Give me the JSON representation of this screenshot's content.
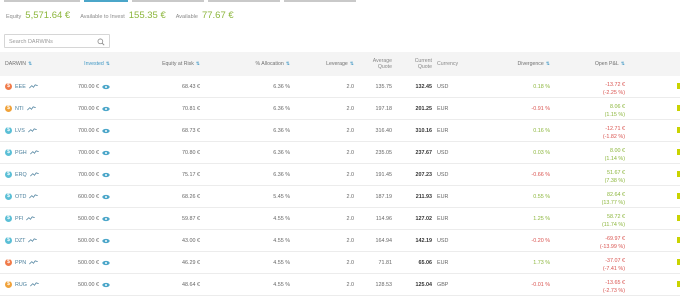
{
  "summary": [
    {
      "label": "Equity",
      "value": "5,571.64 €"
    },
    {
      "label": "Available to Invest",
      "value": "155.35 €"
    },
    {
      "label": "Available",
      "value": "77.67 €"
    }
  ],
  "search": {
    "placeholder": "Search DARWINs"
  },
  "columns": [
    {
      "label": "DARWIN",
      "sort": "⇅"
    },
    {
      "label": "Invested",
      "sort": "⇅"
    },
    {
      "label": "Equity at Risk",
      "sort": "⇅"
    },
    {
      "label": "% Allocation",
      "sort": "⇅"
    },
    {
      "label": "Leverage",
      "sort": "⇅"
    },
    {
      "label": "Average Quote",
      "sort": ""
    },
    {
      "label": "Current Quote",
      "sort": ""
    },
    {
      "label": "Currency",
      "sort": ""
    },
    {
      "label": "Divergence",
      "sort": "⇅"
    },
    {
      "label": "Open P&L",
      "sort": "⇅"
    }
  ],
  "rows": [
    {
      "name": "EEE",
      "icon_color": "#f07b4a",
      "invested": "700.00 €",
      "risk": "68.43 €",
      "alloc": "6.36 %",
      "leverage": "2.0",
      "avg": "135.75",
      "cur": "132.45",
      "currency": "USD",
      "div": "0.18 %",
      "div_sign": "pos",
      "pnl": "-13.72 €",
      "pnl_pct": "(-2.25 %)",
      "pnl_sign": "neg"
    },
    {
      "name": "NTI",
      "icon_color": "#f0a23a",
      "invested": "700.00 €",
      "risk": "70.81 €",
      "alloc": "6.36 %",
      "leverage": "2.0",
      "avg": "197.18",
      "cur": "201.25",
      "currency": "EUR",
      "div": "-0.91 %",
      "div_sign": "neg",
      "pnl": "8.06 €",
      "pnl_pct": "(1.15 %)",
      "pnl_sign": "pos"
    },
    {
      "name": "LVS",
      "icon_color": "#5bbfd6",
      "invested": "700.00 €",
      "risk": "68.73 €",
      "alloc": "6.36 %",
      "leverage": "2.0",
      "avg": "316.40",
      "cur": "310.16",
      "currency": "EUR",
      "div": "0.16 %",
      "div_sign": "pos",
      "pnl": "-12.71 €",
      "pnl_pct": "(-1.82 %)",
      "pnl_sign": "neg"
    },
    {
      "name": "PGH",
      "icon_color": "#5bbfd6",
      "invested": "700.00 €",
      "risk": "70.80 €",
      "alloc": "6.36 %",
      "leverage": "2.0",
      "avg": "235.05",
      "cur": "237.67",
      "currency": "USD",
      "div": "0.03 %",
      "div_sign": "pos",
      "pnl": "8.00 €",
      "pnl_pct": "(1.14 %)",
      "pnl_sign": "pos"
    },
    {
      "name": "ERQ",
      "icon_color": "#5bbfd6",
      "invested": "700.00 €",
      "risk": "75.17 €",
      "alloc": "6.36 %",
      "leverage": "2.0",
      "avg": "191.45",
      "cur": "207.23",
      "currency": "USD",
      "div": "-0.66 %",
      "div_sign": "neg",
      "pnl": "51.67 €",
      "pnl_pct": "(7.38 %)",
      "pnl_sign": "pos"
    },
    {
      "name": "OTD",
      "icon_color": "#5bbfd6",
      "invested": "600.00 €",
      "risk": "68.26 €",
      "alloc": "5.45 %",
      "leverage": "2.0",
      "avg": "187.19",
      "cur": "211.93",
      "currency": "EUR",
      "div": "0.55 %",
      "div_sign": "pos",
      "pnl": "82.64 €",
      "pnl_pct": "(13.77 %)",
      "pnl_sign": "pos"
    },
    {
      "name": "PFI",
      "icon_color": "#5bbfd6",
      "invested": "500.00 €",
      "risk": "59.87 €",
      "alloc": "4.55 %",
      "leverage": "2.0",
      "avg": "114.96",
      "cur": "127.02",
      "currency": "EUR",
      "div": "1.25 %",
      "div_sign": "pos",
      "pnl": "58.72 €",
      "pnl_pct": "(11.74 %)",
      "pnl_sign": "pos"
    },
    {
      "name": "DZT",
      "icon_color": "#5bbfd6",
      "invested": "500.00 €",
      "risk": "43.00 €",
      "alloc": "4.55 %",
      "leverage": "2.0",
      "avg": "164.94",
      "cur": "142.19",
      "currency": "USD",
      "div": "-0.20 %",
      "div_sign": "neg",
      "pnl": "-69.97 €",
      "pnl_pct": "(-13.99 %)",
      "pnl_sign": "neg"
    },
    {
      "name": "PPN",
      "icon_color": "#f07b4a",
      "invested": "500.00 €",
      "risk": "46.29 €",
      "alloc": "4.55 %",
      "leverage": "2.0",
      "avg": "71.81",
      "cur": "65.06",
      "currency": "EUR",
      "div": "1.73 %",
      "div_sign": "pos",
      "pnl": "-37.07 €",
      "pnl_pct": "(-7.41 %)",
      "pnl_sign": "neg"
    },
    {
      "name": "RUG",
      "icon_color": "#f0a23a",
      "invested": "500.00 €",
      "risk": "48.64 €",
      "alloc": "4.55 %",
      "leverage": "2.0",
      "avg": "128.53",
      "cur": "125.04",
      "currency": "GBP",
      "div": "-0.01 %",
      "div_sign": "neg",
      "pnl": "-13.65 €",
      "pnl_pct": "(-2.73 %)",
      "pnl_sign": "neg"
    }
  ],
  "colors": {
    "positive": "#8cb63c",
    "negative": "#d9534f",
    "link": "#3f97c4"
  }
}
